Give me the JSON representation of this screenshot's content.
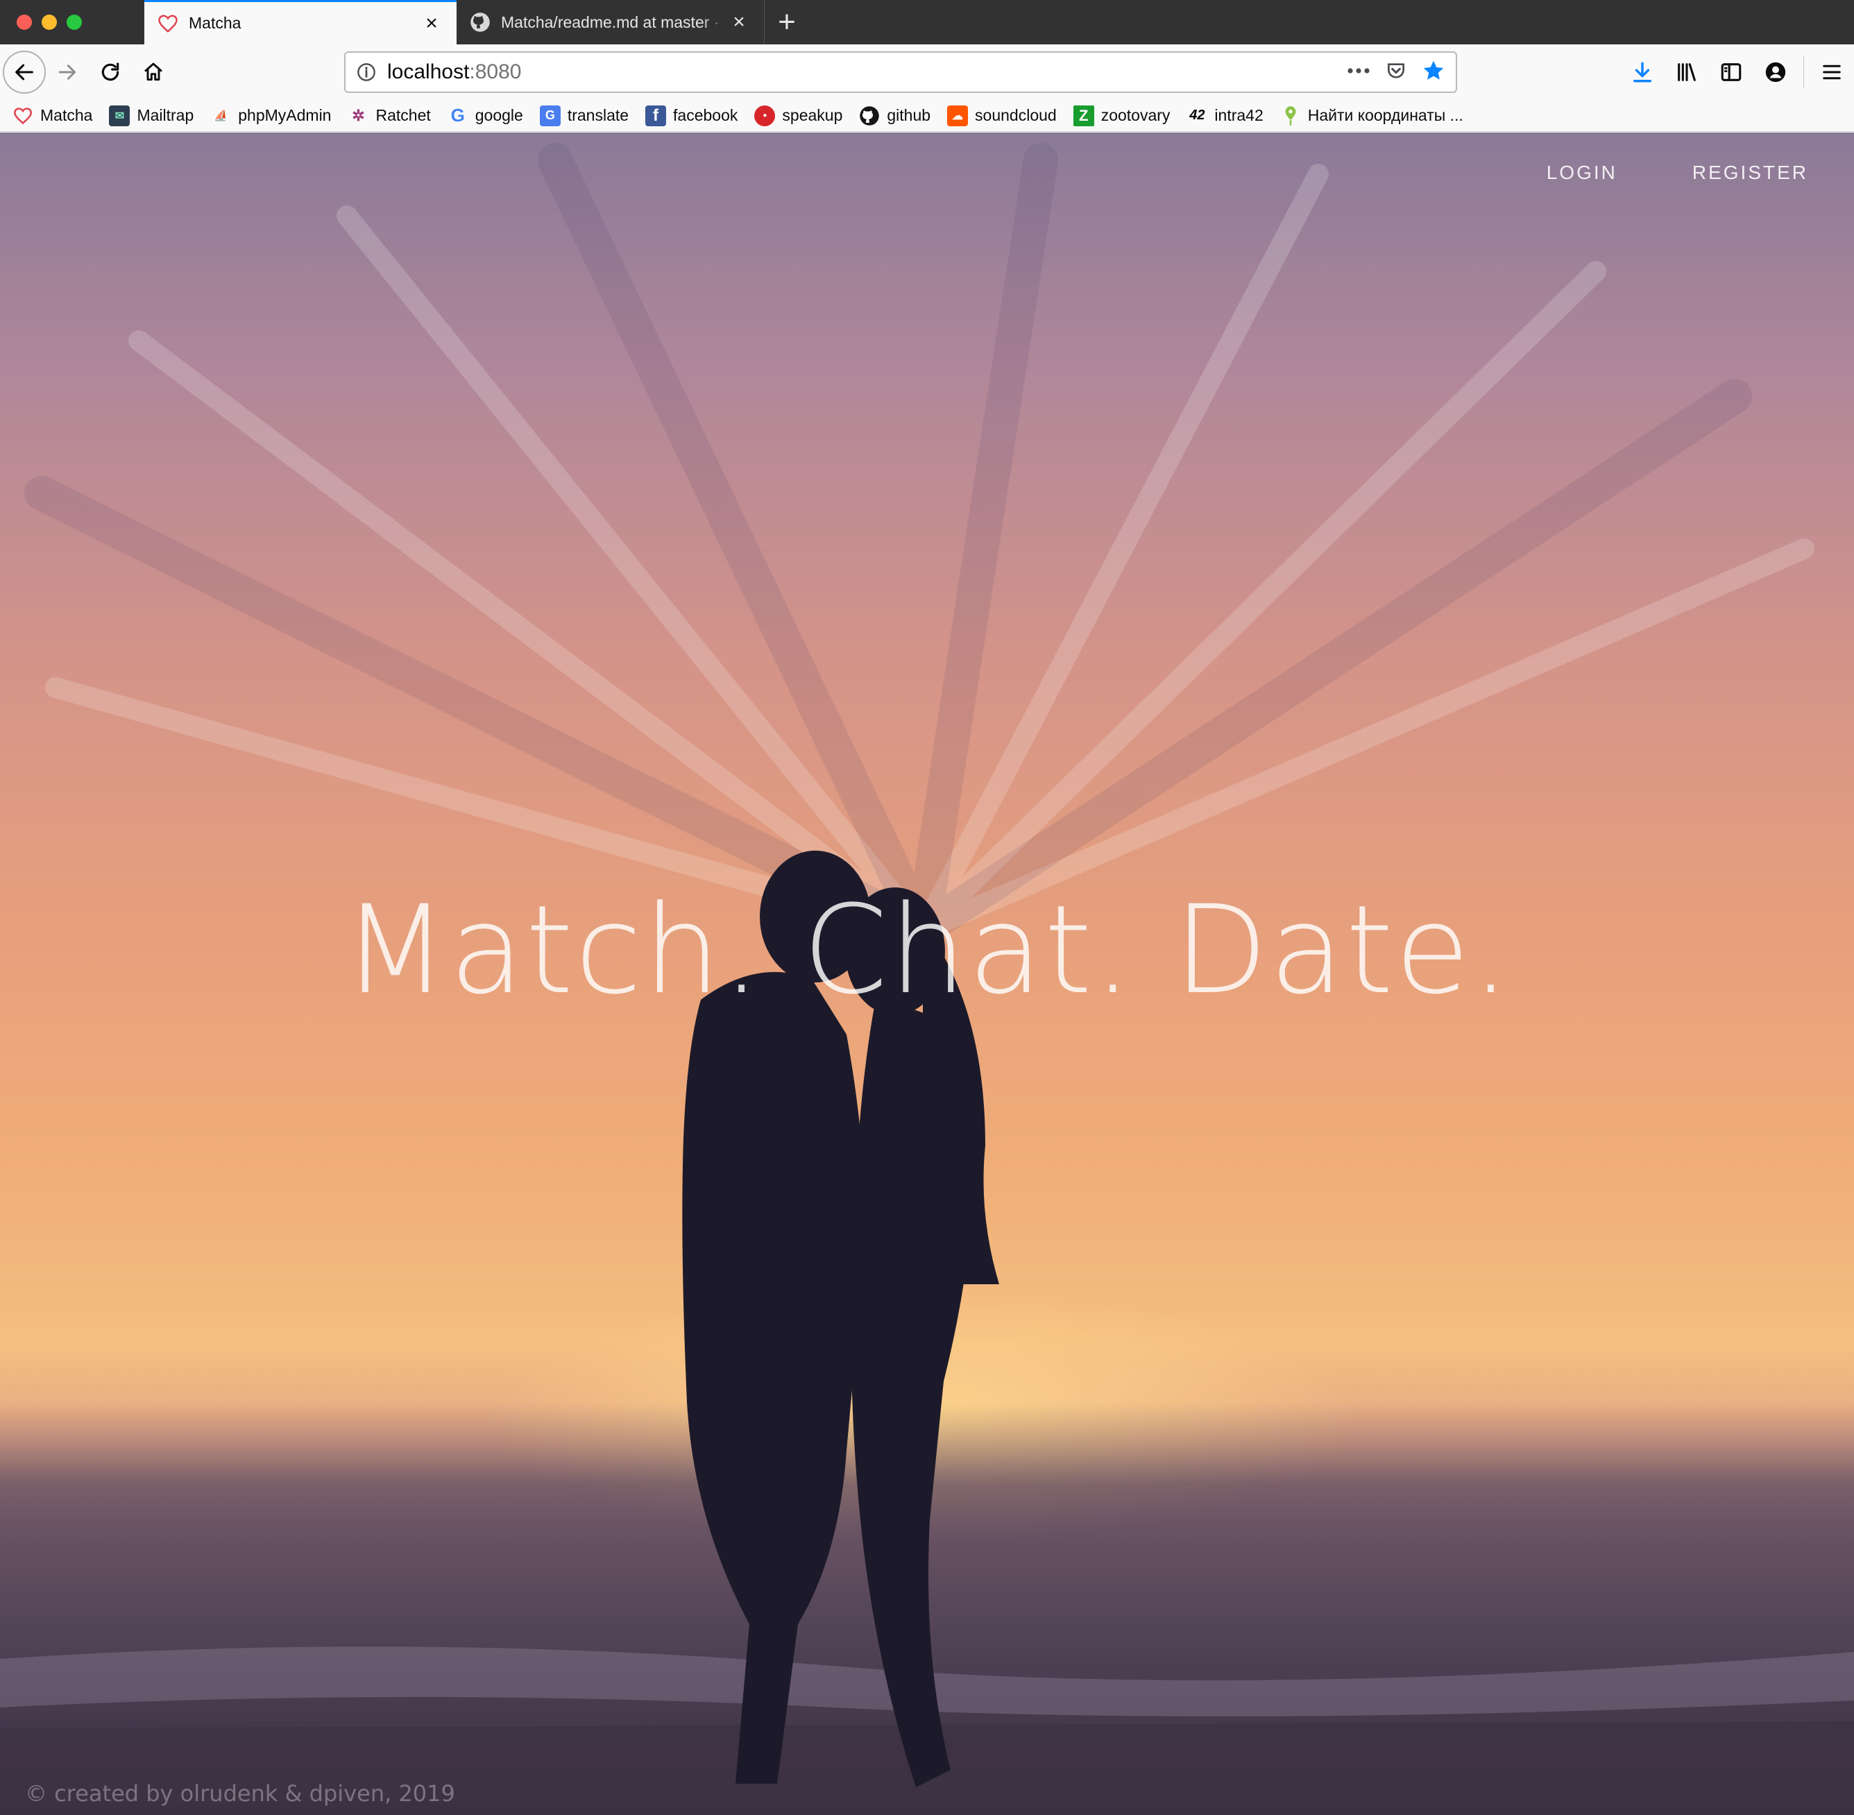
{
  "browser": {
    "tabs": [
      {
        "title": "Matcha",
        "favicon": "heart-icon",
        "active": true
      },
      {
        "title": "Matcha/readme.md at master · ",
        "favicon": "github-icon",
        "active": false
      }
    ],
    "url": {
      "host": "localhost",
      "rest": ":8080"
    },
    "bookmarks": [
      {
        "label": "Matcha",
        "icon": "heart-icon",
        "color": "#e0434f"
      },
      {
        "label": "Mailtrap",
        "icon": "mailtrap-icon",
        "color": "#2d3e50"
      },
      {
        "label": "phpMyAdmin",
        "icon": "pma-icon",
        "color": "#f29b1d"
      },
      {
        "label": "Ratchet",
        "icon": "ratchet-icon",
        "color": "#9b3b7a"
      },
      {
        "label": "google",
        "icon": "google-icon",
        "color": "#4285f4"
      },
      {
        "label": "translate",
        "icon": "translate-icon",
        "color": "#4a7dee"
      },
      {
        "label": "facebook",
        "icon": "facebook-icon",
        "color": "#3b5998"
      },
      {
        "label": "speakup",
        "icon": "speakup-icon",
        "color": "#d7262a"
      },
      {
        "label": "github",
        "icon": "github-icon",
        "color": "#161614"
      },
      {
        "label": "soundcloud",
        "icon": "soundcloud-icon",
        "color": "#ff5500"
      },
      {
        "label": "zootovary",
        "icon": "zootovary-icon",
        "color": "#1a9d2f"
      },
      {
        "label": "intra42",
        "icon": "intra42-icon",
        "color": "#000000"
      },
      {
        "label": "Найти координаты ...",
        "icon": "map-pin-icon",
        "color": "#8bc34a"
      }
    ]
  },
  "page": {
    "nav": {
      "login": "LOGIN",
      "register": "REGISTER"
    },
    "hero": "Match. Chat. Date.",
    "footer": "© created by olrudenk & dpiven, 2019"
  },
  "colors": {
    "accent": "#0a84ff",
    "tabstrip": "#323233"
  }
}
